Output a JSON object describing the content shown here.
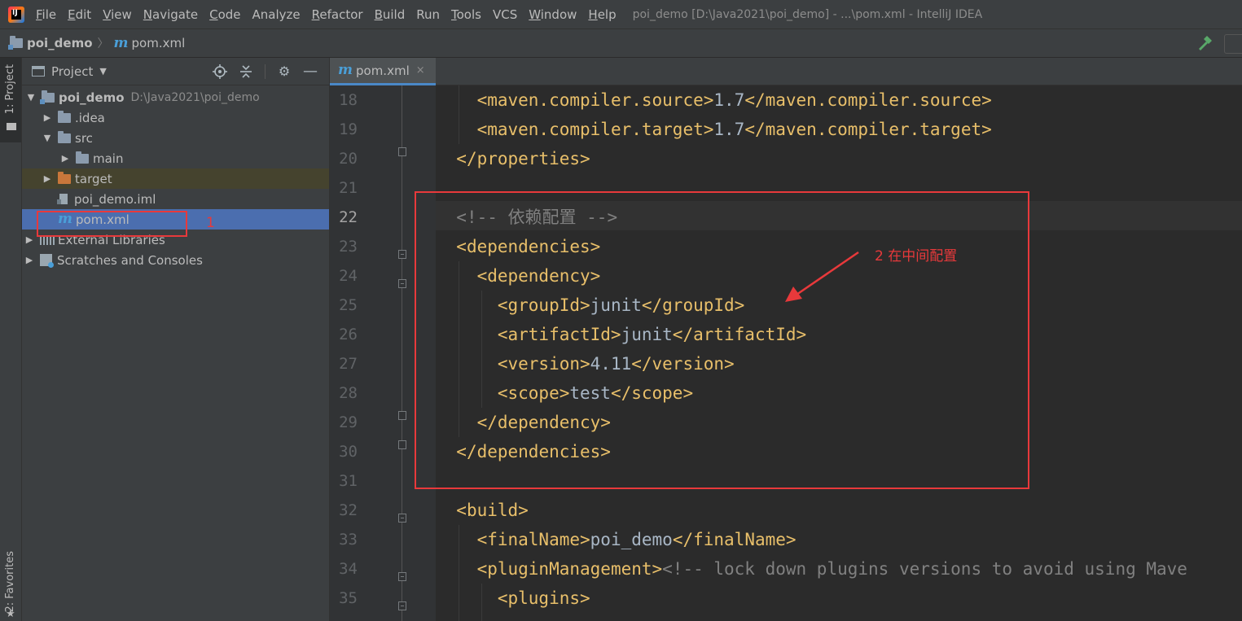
{
  "menu": {
    "app_logo": "intellij-idea-icon",
    "items": [
      {
        "label": "File",
        "mnemonic": "F",
        "rest": "ile"
      },
      {
        "label": "Edit",
        "mnemonic": "E",
        "rest": "dit"
      },
      {
        "label": "View",
        "mnemonic": "V",
        "rest": "iew"
      },
      {
        "label": "Navigate",
        "mnemonic": "N",
        "rest": "avigate"
      },
      {
        "label": "Code",
        "mnemonic": "C",
        "rest": "ode"
      },
      {
        "label": "Analyze",
        "mnemonic": "",
        "rest": "Analyze"
      },
      {
        "label": "Refactor",
        "mnemonic": "R",
        "rest": "efactor"
      },
      {
        "label": "Build",
        "mnemonic": "B",
        "rest": "uild"
      },
      {
        "label": "Run",
        "mnemonic": "",
        "rest": "Run"
      },
      {
        "label": "Tools",
        "mnemonic": "T",
        "rest": "ools"
      },
      {
        "label": "VCS",
        "mnemonic": "",
        "rest": "VCS"
      },
      {
        "label": "Window",
        "mnemonic": "W",
        "rest": "indow"
      },
      {
        "label": "Help",
        "mnemonic": "H",
        "rest": "elp"
      }
    ],
    "window_title": "poi_demo [D:\\Java2021\\poi_demo] - ...\\pom.xml - IntelliJ IDEA"
  },
  "navbar": {
    "project": "poi_demo",
    "separator": "〉",
    "file": "pom.xml",
    "build_icon": "hammer-icon"
  },
  "toolstrip": {
    "project_tab": "1: Project",
    "favorites_tab": "2: Favorites"
  },
  "project_panel": {
    "title": "Project",
    "tools": [
      "locate-icon",
      "collapse-icon",
      "gear-icon",
      "minimize-icon"
    ],
    "tree": [
      {
        "label": "poi_demo",
        "path": "D:\\Java2021\\poi_demo",
        "expanded": true
      },
      {
        "label": ".idea",
        "expanded": false
      },
      {
        "label": "src",
        "expanded": true
      },
      {
        "label": "main",
        "expanded": false
      },
      {
        "label": "target",
        "expanded": false
      },
      {
        "label": "poi_demo.iml"
      },
      {
        "label": "pom.xml",
        "selected": true
      },
      {
        "label": "External Libraries",
        "expanded": false
      },
      {
        "label": "Scratches and Consoles",
        "expanded": false
      }
    ]
  },
  "editor": {
    "tab_label": "pom.xml",
    "close": "×",
    "current_line": 22,
    "lines": [
      {
        "n": "18",
        "text": "    <maven.compiler.source>1.7</maven.compiler.source>"
      },
      {
        "n": "19",
        "text": "    <maven.compiler.target>1.7</maven.compiler.target>"
      },
      {
        "n": "20",
        "text": "  </properties>"
      },
      {
        "n": "21",
        "text": ""
      },
      {
        "n": "22",
        "text": "  <!-- 依赖配置 -->"
      },
      {
        "n": "23",
        "text": "  <dependencies>"
      },
      {
        "n": "24",
        "text": "    <dependency>"
      },
      {
        "n": "25",
        "text": "      <groupId>junit</groupId>"
      },
      {
        "n": "26",
        "text": "      <artifactId>junit</artifactId>"
      },
      {
        "n": "27",
        "text": "      <version>4.11</version>"
      },
      {
        "n": "28",
        "text": "      <scope>test</scope>"
      },
      {
        "n": "29",
        "text": "    </dependency>"
      },
      {
        "n": "30",
        "text": "  </dependencies>"
      },
      {
        "n": "31",
        "text": ""
      },
      {
        "n": "32",
        "text": "  <build>"
      },
      {
        "n": "33",
        "text": "    <finalName>poi_demo</finalName>"
      },
      {
        "n": "34",
        "text": "    <pluginManagement><!-- lock down plugins versions to avoid using Mave"
      },
      {
        "n": "35",
        "text": "      <plugins>"
      }
    ]
  },
  "annotations": {
    "label_1": "1",
    "label_2": "2 在中间配置",
    "color": "#e8393b"
  },
  "colors": {
    "tag": "#e8bf6a",
    "value": "#a9b7c6",
    "comment": "#808080",
    "selection": "#4b6eaf",
    "editor_bg": "#2b2b2b"
  }
}
